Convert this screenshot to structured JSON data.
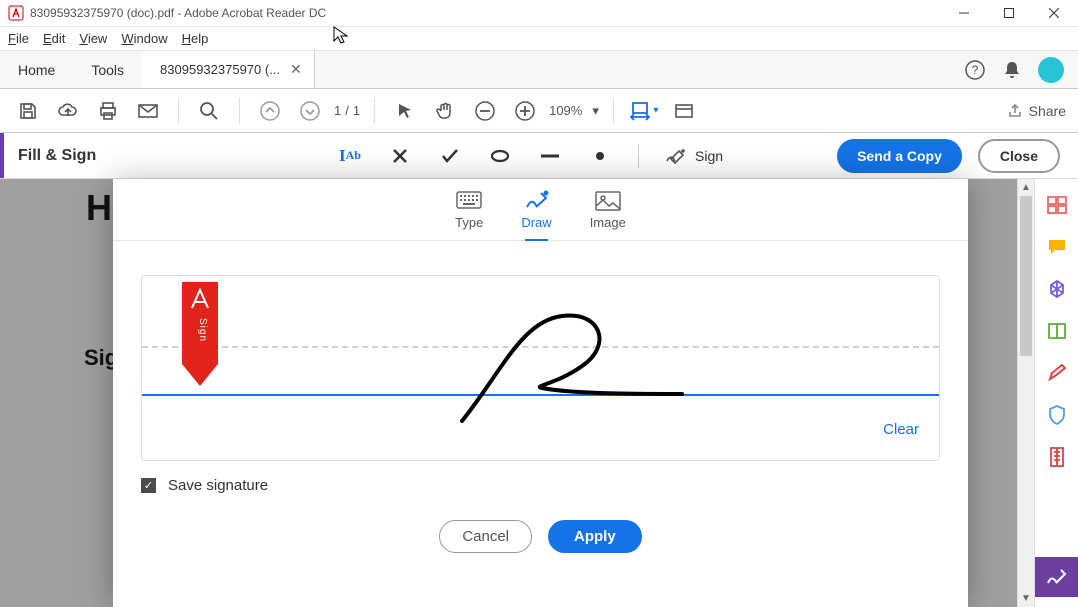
{
  "window": {
    "title": "83095932375970 (doc).pdf - Adobe Acrobat Reader DC"
  },
  "menu": {
    "file": "File",
    "edit": "Edit",
    "view": "View",
    "window": "Window",
    "help": "Help"
  },
  "tabs": {
    "home": "Home",
    "tools": "Tools",
    "doc": "83095932375970 (..."
  },
  "toolbar": {
    "page_current": "1",
    "page_sep": "/",
    "page_total": "1",
    "zoom": "109%",
    "share": "Share"
  },
  "fillsign": {
    "title": "Fill & Sign",
    "sign": "Sign",
    "send": "Send a Copy",
    "close": "Close"
  },
  "dialog": {
    "tab_type": "Type",
    "tab_draw": "Draw",
    "tab_image": "Image",
    "clear": "Clear",
    "save": "Save signature",
    "cancel": "Cancel",
    "apply": "Apply",
    "ribbon": "Sign"
  },
  "bg": {
    "h": "H",
    "s": "Sig"
  }
}
